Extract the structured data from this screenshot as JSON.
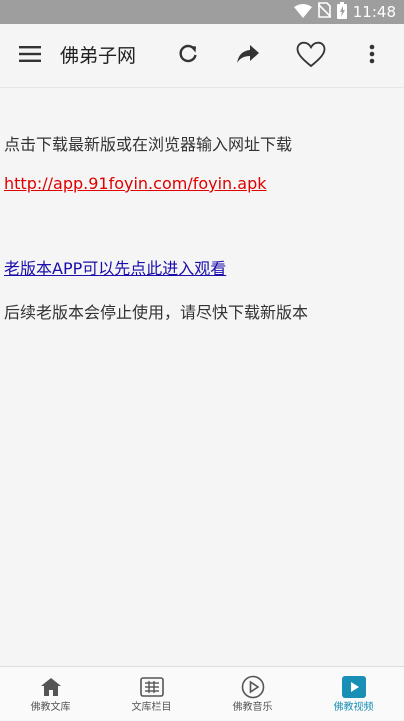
{
  "status_bar": {
    "time": "11:48"
  },
  "toolbar": {
    "title": "佛弟子网",
    "menu_icon": "menu-icon",
    "refresh_icon": "refresh-icon",
    "share_icon": "share-icon",
    "favorite_icon": "heart-icon",
    "more_icon": "more-vert-icon"
  },
  "content": {
    "download_instruction": "点击下载最新版或在浏览器输入网址下载",
    "download_url": "http://app.91foyin.com/foyin.apk",
    "old_version_link": "老版本APP可以先点此进入观看",
    "notice": "后续老版本会停止使用，请尽快下载新版本"
  },
  "bottom_nav": {
    "items": [
      {
        "label": "佛教文库",
        "icon": "home-icon",
        "active": false
      },
      {
        "label": "文库栏目",
        "icon": "grid-icon",
        "active": false
      },
      {
        "label": "佛教音乐",
        "icon": "play-circle-icon",
        "active": false
      },
      {
        "label": "佛教视频",
        "icon": "video-icon",
        "active": true
      }
    ]
  },
  "colors": {
    "status_bar": "#9e9e9e",
    "background": "#f5f5f5",
    "link_red": "#e00000",
    "link_blue": "#1a0dab",
    "active_tab": "#1a8fb5"
  }
}
